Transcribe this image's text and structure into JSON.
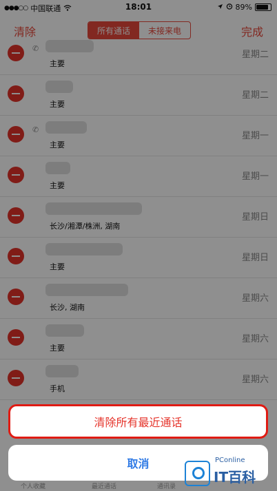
{
  "status_bar": {
    "carrier": "中国联通",
    "time": "18:01",
    "battery": "89%"
  },
  "nav": {
    "left": "清除",
    "tab_all": "所有通话",
    "tab_missed": "未接来电",
    "right": "完成"
  },
  "calls": [
    {
      "sub": "主要",
      "day": "星期二",
      "phone_icon": true
    },
    {
      "sub": "主要",
      "day": "星期二",
      "phone_icon": false
    },
    {
      "sub": "主要",
      "day": "星期一",
      "phone_icon": true
    },
    {
      "sub": "主要",
      "day": "星期一",
      "phone_icon": false
    },
    {
      "sub": "长沙/湘潭/株洲, 湖南",
      "day": "星期日",
      "phone_icon": false
    },
    {
      "sub": "主要",
      "day": "星期日",
      "phone_icon": false
    },
    {
      "sub": "长沙, 湖南",
      "day": "星期六",
      "phone_icon": false
    },
    {
      "sub": "主要",
      "day": "星期六",
      "phone_icon": false
    },
    {
      "sub": "手机",
      "day": "星期六",
      "phone_icon": false
    }
  ],
  "action_sheet": {
    "clear_all": "清除所有最近通话",
    "cancel": "取消"
  },
  "tab_bar": {
    "favorites": "个人收藏",
    "recents": "最近通话",
    "contacts": "通讯录"
  },
  "watermark": {
    "brand": "PConline",
    "name": "IT百科"
  },
  "colors": {
    "accent": "#e8483b",
    "destructive": "#e5332a",
    "cancel": "#2f7ae5",
    "highlight": "#e01b13"
  }
}
